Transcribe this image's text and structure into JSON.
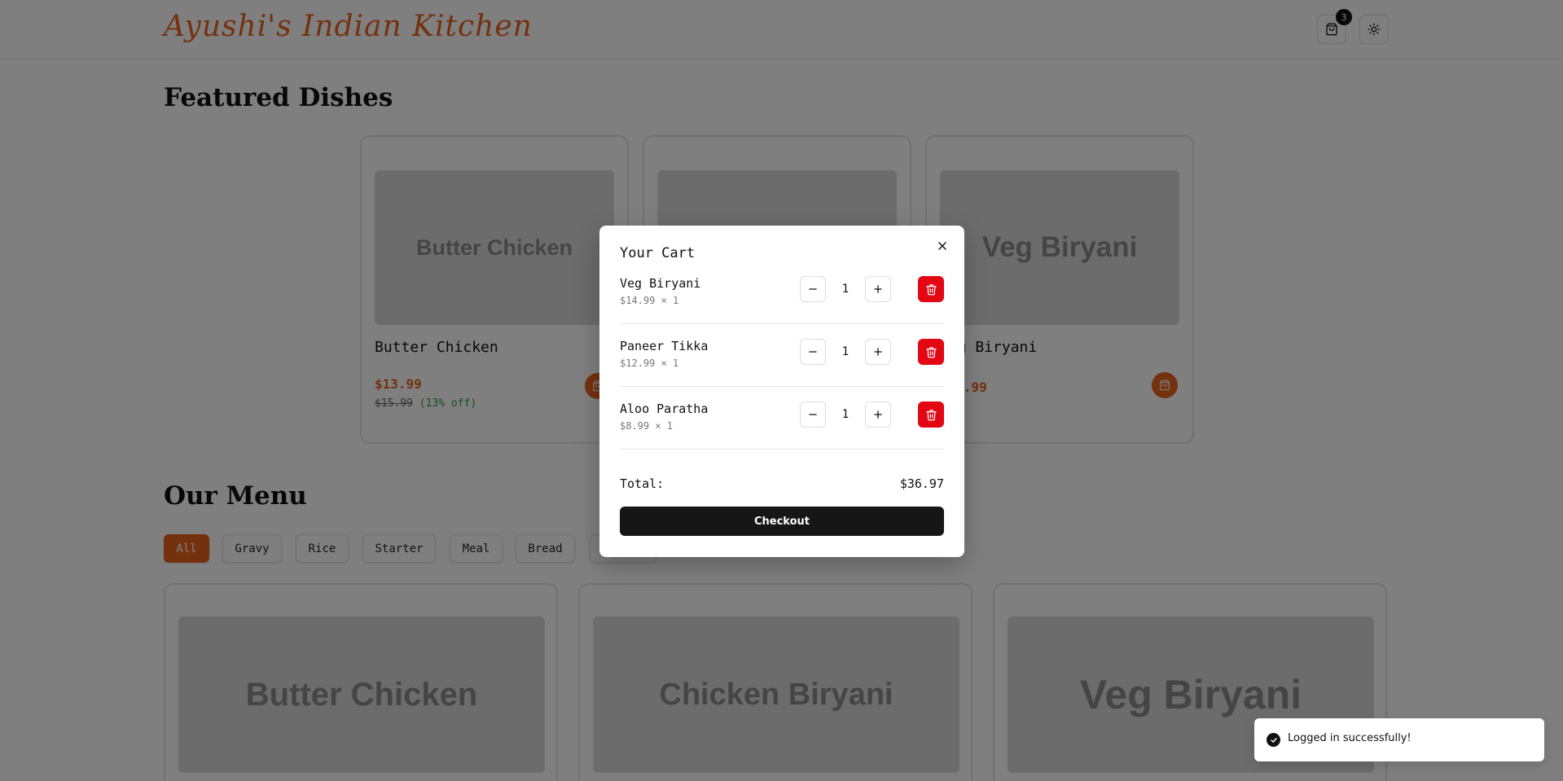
{
  "header": {
    "brand": "Ayushi's Indian Kitchen",
    "cart_count": "3"
  },
  "featured": {
    "title": "Featured Dishes",
    "cards": [
      {
        "image_label": "Butter Chicken",
        "name": "Butter Chicken",
        "price": "$13.99",
        "old_price": "$15.99",
        "discount": "(13% off)"
      },
      {
        "image_label": "",
        "name": "",
        "price": ""
      },
      {
        "image_label": "Veg Biryani",
        "name": "Veg Biryani",
        "price": "$14.99"
      }
    ]
  },
  "menu": {
    "title": "Our Menu",
    "filters": [
      "All",
      "Gravy",
      "Rice",
      "Starter",
      "Meal",
      "Bread",
      ""
    ],
    "active_filter": "All",
    "cards": [
      {
        "image_label": "Butter Chicken"
      },
      {
        "image_label": "Chicken Biryani"
      },
      {
        "image_label": "Veg Biryani"
      }
    ]
  },
  "cart": {
    "title": "Your Cart",
    "items": [
      {
        "name": "Veg Biryani",
        "sub": "$14.99 × 1",
        "qty": "1"
      },
      {
        "name": "Paneer Tikka",
        "sub": "$12.99 × 1",
        "qty": "1"
      },
      {
        "name": "Aloo Paratha",
        "sub": "$8.99 × 1",
        "qty": "1"
      }
    ],
    "total_label": "Total:",
    "total_value": "$36.97",
    "checkout_label": "Checkout"
  },
  "toast": {
    "message": "Logged in successfully!"
  },
  "icons": {
    "cart": "shopping-bag-icon",
    "theme": "sun-icon",
    "close": "close-icon",
    "minus": "minus-icon",
    "plus": "plus-icon",
    "delete": "trash-icon",
    "success": "check-circle-icon"
  },
  "colors": {
    "accent": "#e8621c",
    "danger": "#e30613",
    "discount": "#2a9d3a",
    "dark": "#161616"
  }
}
